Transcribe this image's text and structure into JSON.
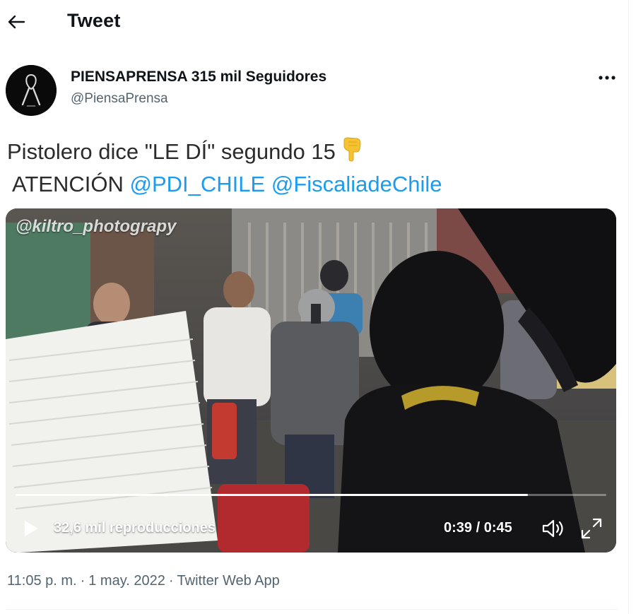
{
  "header": {
    "title": "Tweet",
    "back_icon": "arrow-left-icon"
  },
  "author": {
    "name_line": "PIENSAPRENSA 315 mil Seguidores",
    "handle": "@PiensaPrensa",
    "avatar_icon": "black-ribbon-avatar",
    "more_icon": "more-dots-icon"
  },
  "tweet": {
    "line1": "Pistolero dice \"LE DÍ\" segundo 15",
    "line1_emoji": "backhand-index-pointing-down-emoji",
    "line2_prefix": "ATENCIÓN",
    "mention1": "@PDI_CHILE",
    "mention2": "@FiscaliadeChile"
  },
  "video": {
    "watermark": "@kiltro_photograpy",
    "views": "32,6 mil reproducciones",
    "time": "0:39 / 0:45",
    "progress": 0.867,
    "play_icon": "play-icon",
    "volume_icon": "volume-icon",
    "fullscreen_icon": "fullscreen-icon"
  },
  "footer": {
    "time": "11:05 p. m.",
    "separator": "·",
    "date": "1 may. 2022",
    "app": "Twitter Web App"
  },
  "colors": {
    "link": "#1d9bf0",
    "secondary": "#536471",
    "text": "#0f1419"
  }
}
